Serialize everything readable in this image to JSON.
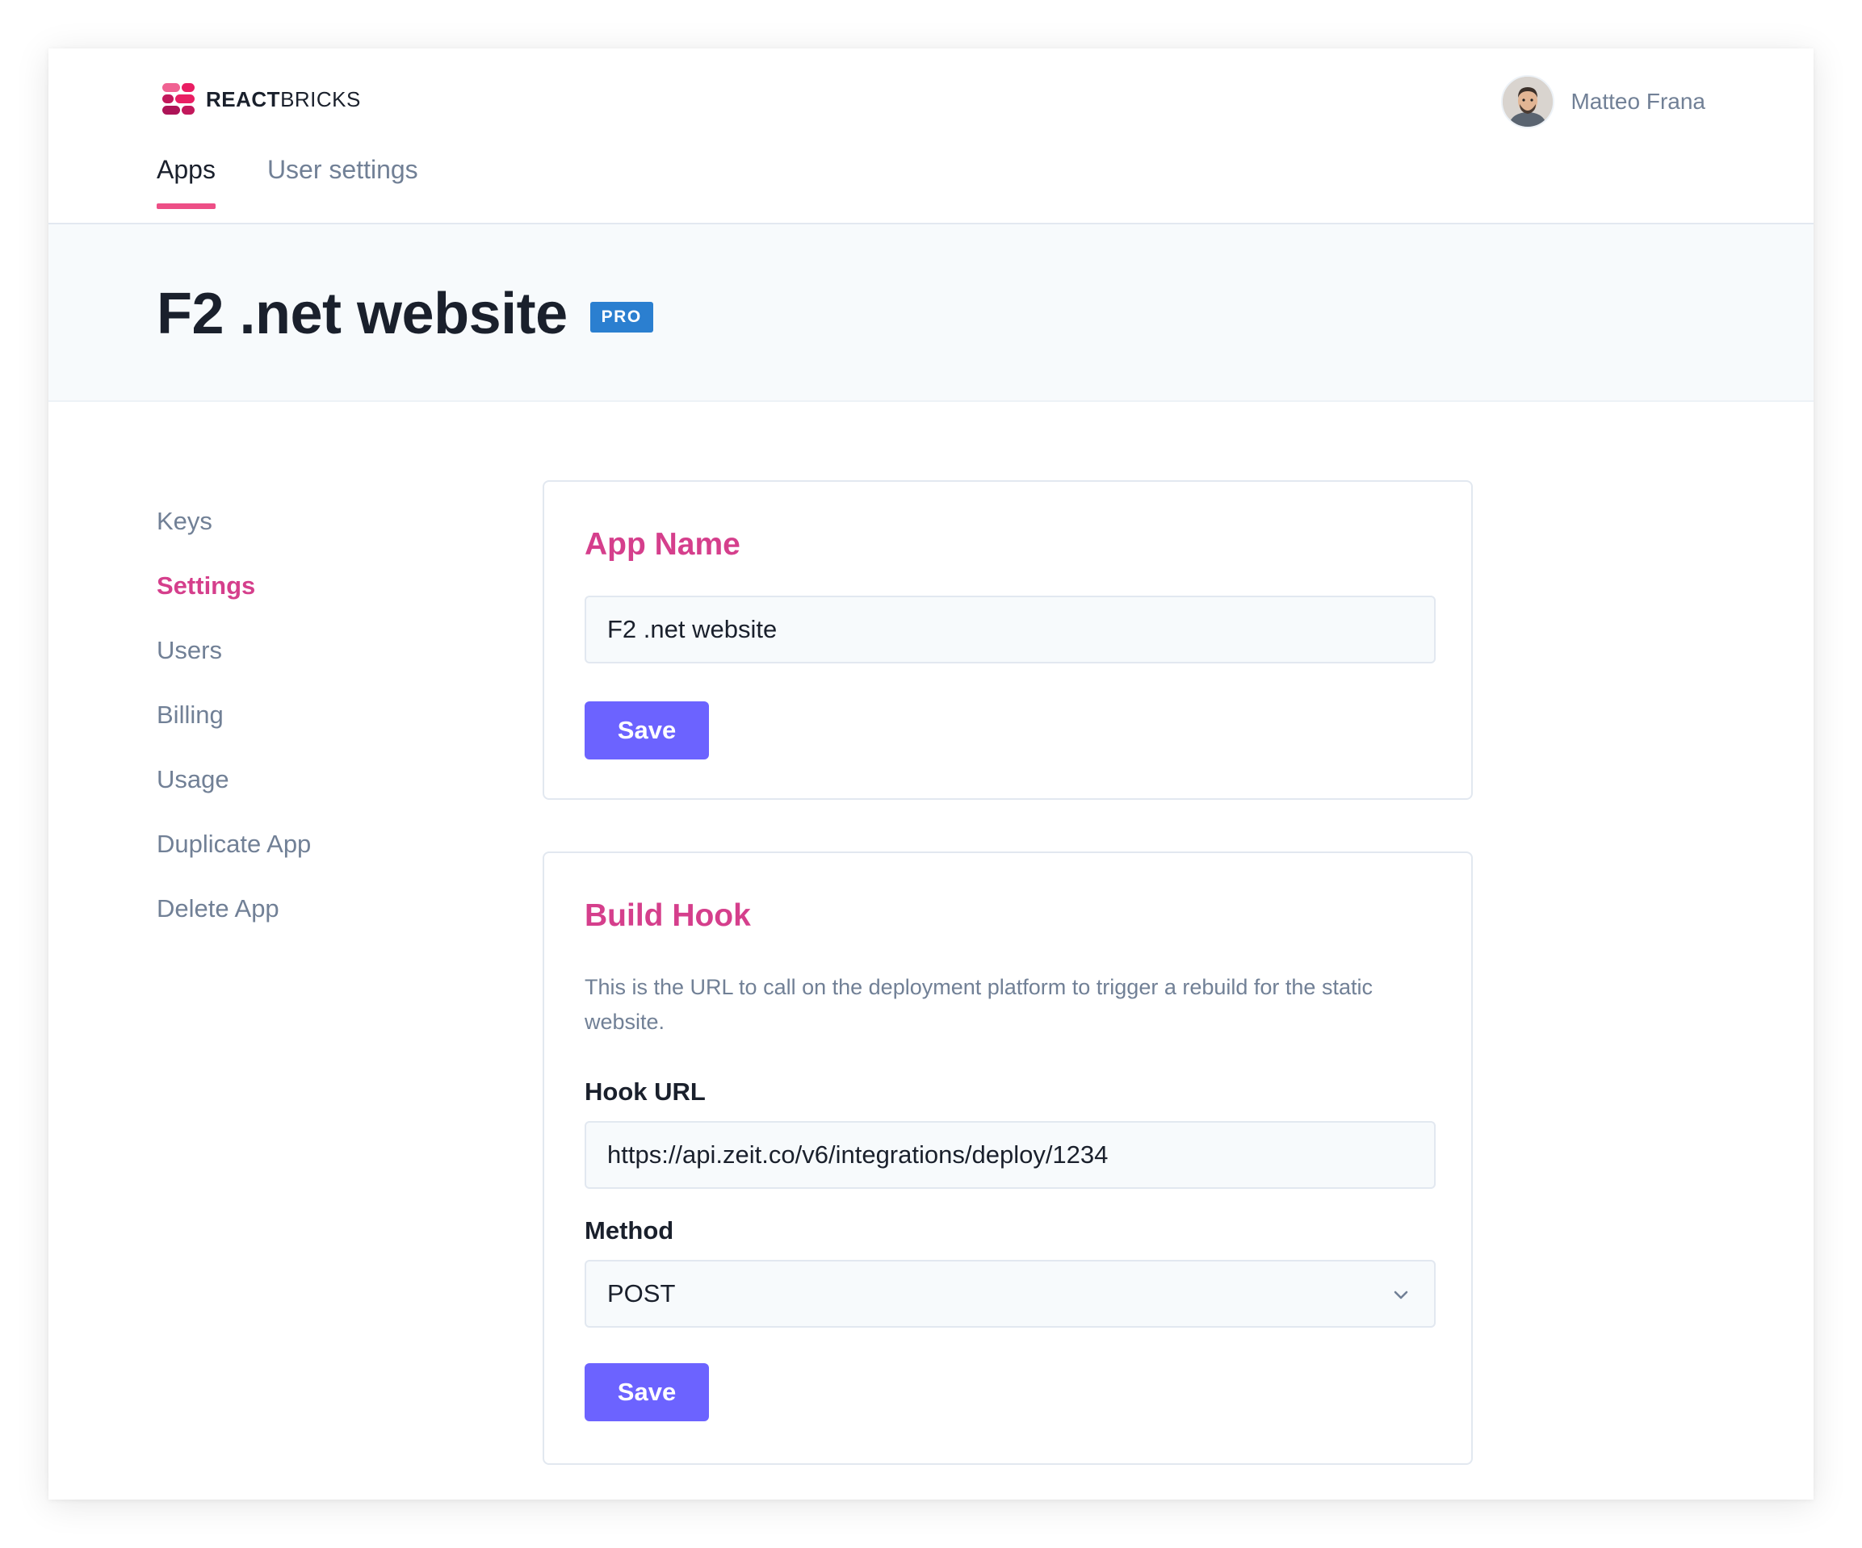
{
  "header": {
    "brand_bold": "REACT",
    "brand_light": "BRICKS",
    "user_name": "Matteo Frana",
    "tabs": [
      {
        "label": "Apps",
        "active": true
      },
      {
        "label": "User settings",
        "active": false
      }
    ]
  },
  "app": {
    "title": "F2 .net website",
    "plan_badge": "PRO"
  },
  "sidebar": {
    "items": [
      {
        "label": "Keys"
      },
      {
        "label": "Settings"
      },
      {
        "label": "Users"
      },
      {
        "label": "Billing"
      },
      {
        "label": "Usage"
      },
      {
        "label": "Duplicate App"
      },
      {
        "label": "Delete App"
      }
    ],
    "active_index": 1
  },
  "app_name_card": {
    "heading": "App Name",
    "value": "F2 .net website",
    "save_label": "Save"
  },
  "build_hook_card": {
    "heading": "Build Hook",
    "description": "This is the URL to call on the deployment platform to trigger a rebuild for the static website.",
    "hook_url_label": "Hook URL",
    "hook_url_value": "https://api.zeit.co/v6/integrations/deploy/1234",
    "method_label": "Method",
    "method_value": "POST",
    "save_label": "Save"
  },
  "colors": {
    "accent_pink": "#d53f8c",
    "tab_underline": "#ed4f86",
    "button": "#6c63ff",
    "badge": "#2b7fd0"
  }
}
